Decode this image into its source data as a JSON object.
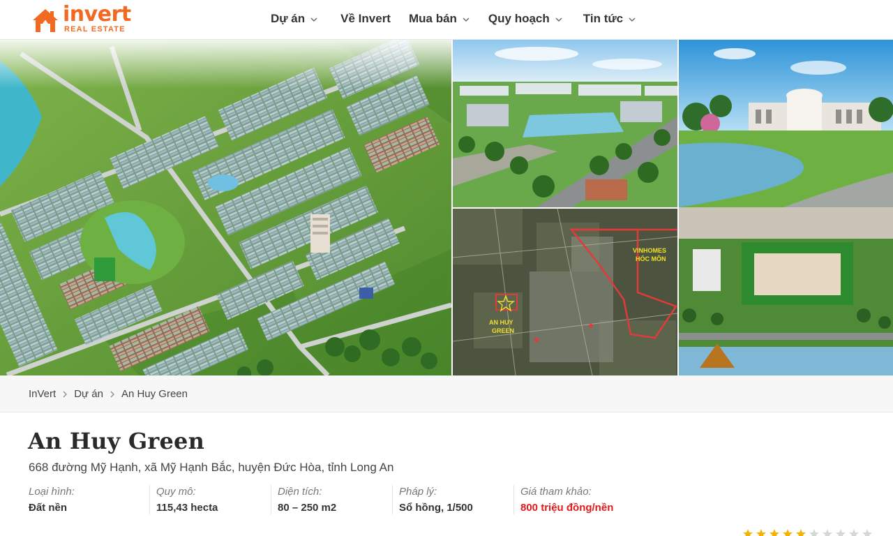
{
  "brand": {
    "name": "invert",
    "tagline": "REAL ESTATE",
    "color": "#f26a21"
  },
  "nav": {
    "items": [
      {
        "label": "Dự án",
        "has_dropdown": true
      },
      {
        "label": "Về Invert",
        "has_dropdown": false
      },
      {
        "label": "Mua bán",
        "has_dropdown": true
      },
      {
        "label": "Quy hoạch",
        "has_dropdown": true
      },
      {
        "label": "Tin tức",
        "has_dropdown": true
      }
    ]
  },
  "gallery": {
    "map_labels": {
      "vinhomes_line1": "VINHOMES",
      "vinhomes_line2": "HÓC MÔN",
      "anhuy_line1": "AN HUY",
      "anhuy_line2": "GREEN"
    }
  },
  "breadcrumb": {
    "items": [
      "InVert",
      "Dự án",
      "An Huy Green"
    ]
  },
  "project": {
    "title": "An Huy Green",
    "address": "668 đường Mỹ Hạnh, xã Mỹ Hạnh Bắc, huyện Đức Hòa, tỉnh Long An",
    "specs": [
      {
        "label": "Loại hình:",
        "value": "Đất nền"
      },
      {
        "label": "Quy mô:",
        "value": "115,43 hecta"
      },
      {
        "label": "Diện tích:",
        "value": "80 – 250 m2"
      },
      {
        "label": "Pháp lý:",
        "value": "Sổ hồng, 1/500"
      },
      {
        "label": "Giá tham khảo:",
        "value": "800 triệu đồng/nền"
      }
    ],
    "price_color": "#e11b1b",
    "rating": {
      "filled": 5,
      "total": 10
    }
  }
}
